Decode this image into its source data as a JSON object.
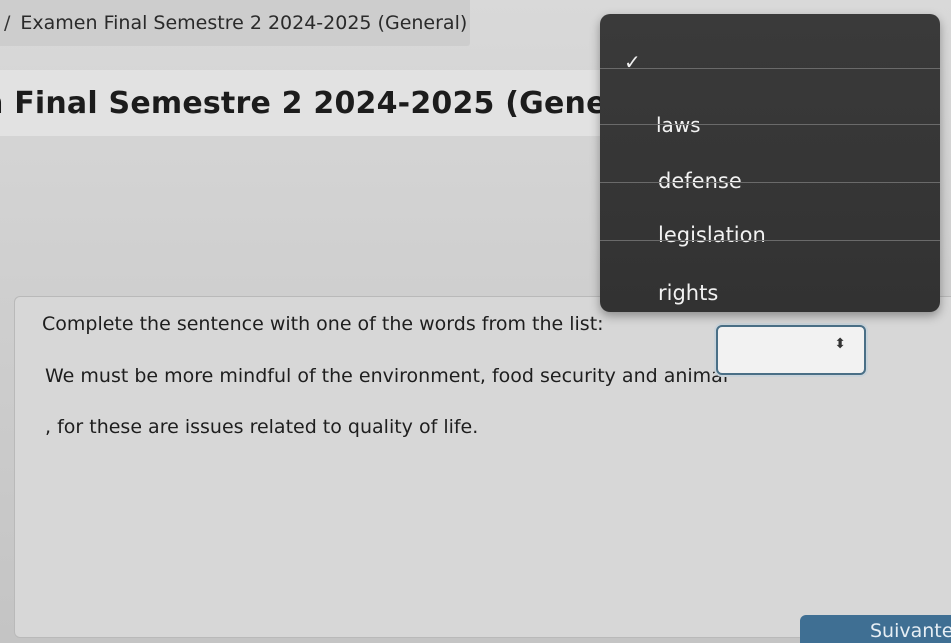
{
  "breadcrumb": {
    "separator": "/",
    "label": "Examen Final Semestre 2 2024-2025 (General)"
  },
  "page": {
    "title": "n Final Semestre 2 2024-2025 (General)"
  },
  "question": {
    "instruction": "Complete the sentence with one of the words from the list:",
    "sentence_start": "We must be more mindful of the environment, food security and animal",
    "sentence_end": ", for these are issues related to quality of life.",
    "selected_value": "",
    "select_arrows": "⬍"
  },
  "dropdown": {
    "check_glyph": "✓",
    "options": [
      {
        "label": "",
        "selected": true
      },
      {
        "label": "laws",
        "selected": false
      },
      {
        "label": "defense",
        "selected": false
      },
      {
        "label": "legislation",
        "selected": false
      },
      {
        "label": "rights",
        "selected": false
      }
    ]
  },
  "footer": {
    "next_label": "Suivante"
  },
  "colors": {
    "dropdown_bg": "#363636",
    "select_border": "#4a6f86",
    "next_button_bg": "#3f6f93"
  }
}
